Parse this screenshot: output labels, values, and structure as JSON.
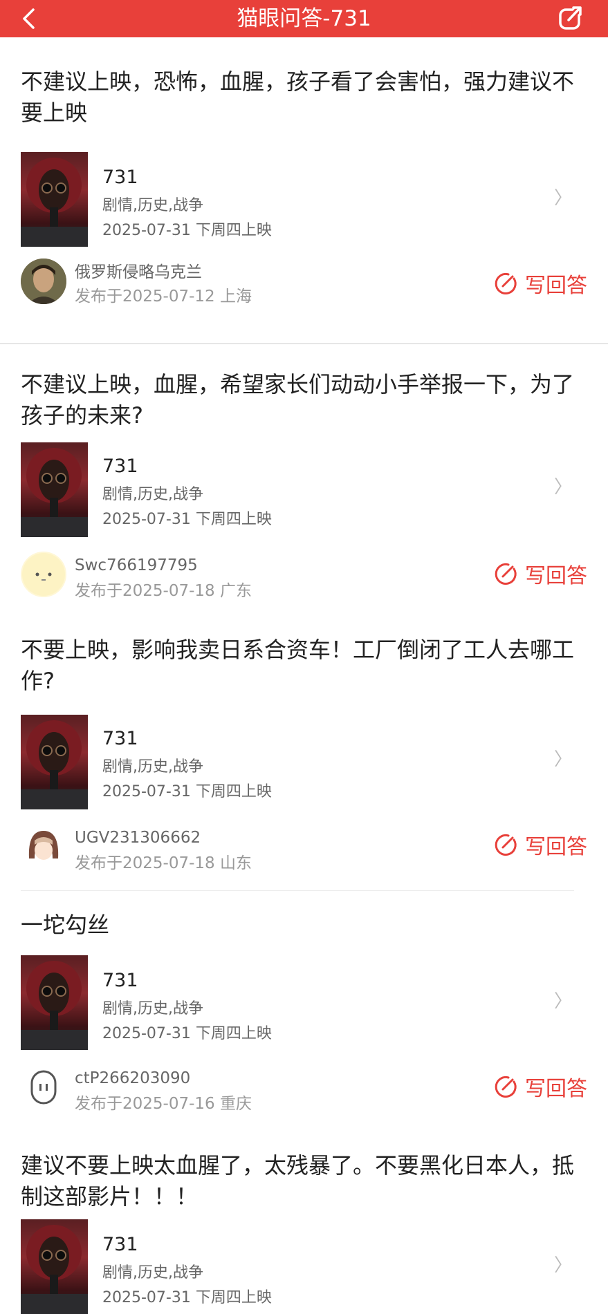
{
  "header": {
    "title": "猫眼问答-731",
    "back_icon": "chevron-left-icon",
    "share_icon": "share-icon"
  },
  "colors": {
    "brand_red": "#e8403a"
  },
  "questions": [
    {
      "text": "不建议上映，恐怖，血腥，孩子看了会害怕，强力建议不要上映",
      "movie": {
        "name": "731",
        "tags": "剧情,历史,战争",
        "release": "2025-07-31 下周四上映"
      },
      "user": {
        "name": "俄罗斯侵略乌克兰",
        "meta": "发布于2025-07-12   上海"
      },
      "answer_label": "写回答"
    },
    {
      "text": "不建议上映，血腥，希望家长们动动小手举报一下，为了孩子的未来?",
      "movie": {
        "name": "731",
        "tags": "剧情,历史,战争",
        "release": "2025-07-31 下周四上映"
      },
      "user": {
        "name": "Swc766197795",
        "meta": "发布于2025-07-18   广东"
      },
      "answer_label": "写回答"
    },
    {
      "text": "不要上映，影响我卖日系合资车！工厂倒闭了工人去哪工作?",
      "movie": {
        "name": "731",
        "tags": "剧情,历史,战争",
        "release": "2025-07-31 下周四上映"
      },
      "user": {
        "name": "UGV231306662",
        "meta": "发布于2025-07-18   山东"
      },
      "answer_label": "写回答"
    },
    {
      "text": "一坨勾丝",
      "movie": {
        "name": "731",
        "tags": "剧情,历史,战争",
        "release": "2025-07-31 下周四上映"
      },
      "user": {
        "name": "ctP266203090",
        "meta": "发布于2025-07-16   重庆"
      },
      "answer_label": "写回答"
    },
    {
      "text": "建议不要上映太血腥了，太残暴了。不要黑化日本人，抵制这部影片！！！",
      "movie": {
        "name": "731",
        "tags": "剧情,历史,战争",
        "release": "2025-07-31 下周四上映"
      }
    }
  ]
}
